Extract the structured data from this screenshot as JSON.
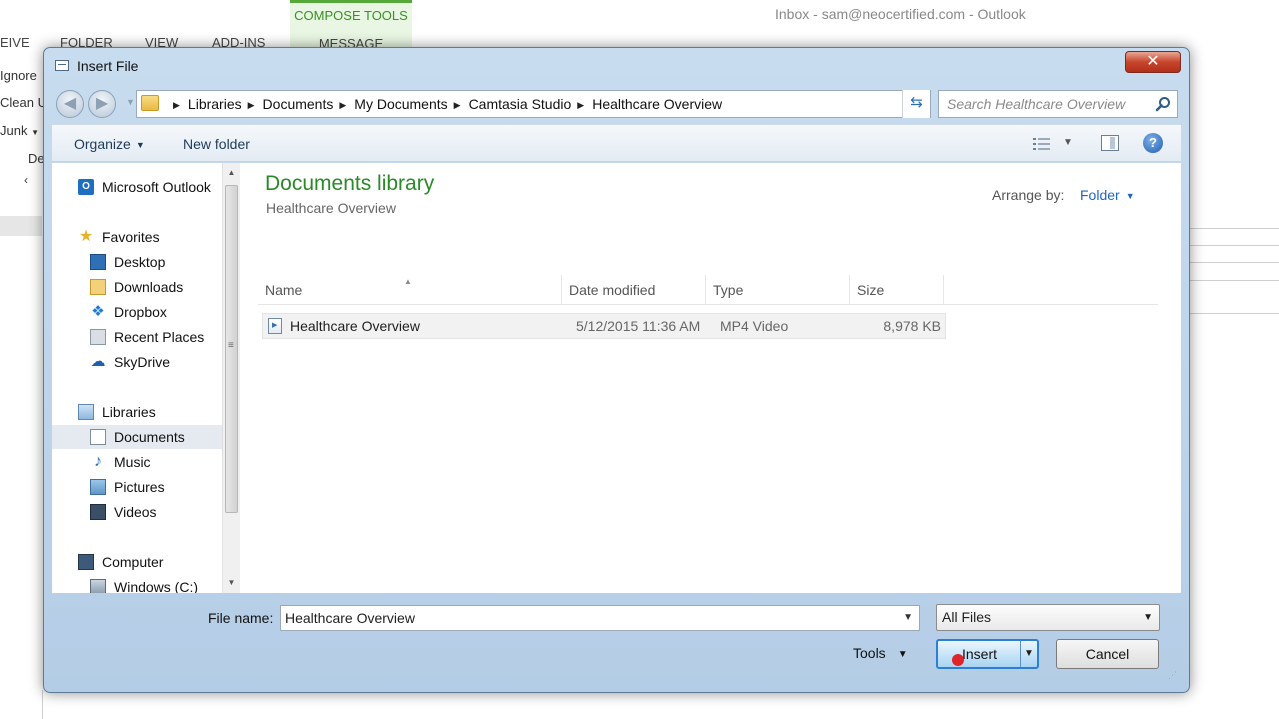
{
  "background_app": {
    "window_title": "Inbox - sam@neocertified.com - Outlook",
    "contextual_tab_group": "COMPOSE TOOLS",
    "contextual_tab": "MESSAGE",
    "ribbon_tabs": [
      "EIVE",
      "FOLDER",
      "VIEW",
      "ADD-INS"
    ],
    "left_items": [
      "Ignore",
      "Clean U",
      "Junk",
      "De"
    ]
  },
  "dialog": {
    "title": "Insert File",
    "close_label": "✕",
    "address": {
      "breadcrumbs": [
        "Libraries",
        "Documents",
        "My Documents",
        "Camtasia Studio",
        "Healthcare Overview"
      ]
    },
    "search": {
      "placeholder": "Search Healthcare Overview"
    },
    "toolbar": {
      "organize_label": "Organize",
      "new_folder_label": "New folder",
      "help_label": "?"
    },
    "nav_pane": {
      "outlook": "Microsoft Outlook",
      "favorites": "Favorites",
      "favorite_items": [
        "Desktop",
        "Downloads",
        "Dropbox",
        "Recent Places",
        "SkyDrive"
      ],
      "libraries": "Libraries",
      "library_items": [
        "Documents",
        "Music",
        "Pictures",
        "Videos"
      ],
      "selected": "Documents",
      "computer": "Computer",
      "computer_items": [
        "Windows (C:)"
      ]
    },
    "content": {
      "library_title": "Documents library",
      "library_subtitle": "Healthcare Overview",
      "arrange_label": "Arrange by:",
      "arrange_value": "Folder",
      "columns": [
        "Name",
        "Date modified",
        "Type",
        "Size"
      ],
      "files": [
        {
          "name": "Healthcare Overview",
          "date_modified": "5/12/2015 11:36 AM",
          "type": "MP4 Video",
          "size": "8,978 KB"
        }
      ]
    },
    "footer": {
      "file_name_label": "File name:",
      "file_name_value": "Healthcare Overview",
      "file_type_value": "All Files",
      "tools_label": "Tools",
      "insert_label": "Insert",
      "cancel_label": "Cancel"
    }
  },
  "colors": {
    "library_title": "#2a8a28",
    "link_blue": "#1f66c2",
    "close_red": "#c7452c",
    "compose_green": "#3b8f25"
  }
}
